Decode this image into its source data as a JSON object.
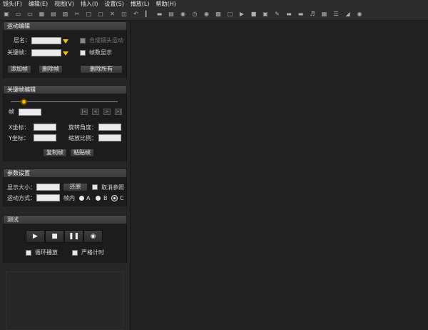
{
  "menubar": {
    "items": [
      {
        "label": "镜头(F)"
      },
      {
        "label": "编辑(E)"
      },
      {
        "label": "视图(V)"
      },
      {
        "label": "插入(I)"
      },
      {
        "label": "设置(S)"
      },
      {
        "label": "播放(L)"
      },
      {
        "label": "帮助(H)"
      }
    ]
  },
  "toolbar": {
    "icons": [
      "camera-icon",
      "open-folder-icon",
      "folder-icon",
      "save-icon",
      "save-as-icon",
      "film-icon",
      "cut-icon",
      "copy-icon",
      "paste-icon",
      "close-icon",
      "delete-icon",
      "undo-icon",
      "align-left-icon",
      "align-center-icon",
      "layer-icon",
      "web-icon",
      "timer-icon",
      "eye-icon",
      "layers-icon",
      "crop-icon",
      "play-icon",
      "stop-icon",
      "frame-icon",
      "pen-icon",
      "move-up-icon",
      "move-down-icon",
      "sound-icon",
      "grid-icon",
      "bars-icon",
      "chart-icon",
      "settings-icon"
    ]
  },
  "motion_edit": {
    "title": "运动编辑",
    "layer_name_label": "层名：",
    "layer_name_value": "",
    "composite_label": "合成镜头运动",
    "keyframe_label": "关键帧：",
    "keyframe_value": "",
    "frame_count_label": "帧数显示",
    "add_frame": "添加帧",
    "delete_frame": "删除帧",
    "delete_all": "删除所有"
  },
  "keyframe_edit": {
    "title": "关键帧编辑",
    "slider_fraction": 0.12,
    "frame_label": "帧",
    "frame_value": "",
    "nav_first": "|<",
    "nav_prev": "<",
    "nav_next": ">",
    "nav_last": ">|",
    "x_label": "X坐标：",
    "x_value": "",
    "rotation_label": "旋转角度：",
    "rotation_value": "",
    "y_label": "Y坐标：",
    "y_value": "",
    "scale_label": "缩放比例：",
    "scale_value": "",
    "copy_frame": "复制帧",
    "paste_frame": "粘贴帧"
  },
  "params": {
    "title": "参数设置",
    "display_size_label": "显示大小：",
    "display_size_value": "",
    "restore_button": "还原",
    "cancel_ref_label": "取消参照",
    "motion_mode_label": "运动方式：",
    "motion_mode_value": "",
    "inter_frame_label": "帧内",
    "option_a": "A",
    "option_b": "B",
    "option_c": "C"
  },
  "test": {
    "title": "测试",
    "loop_label": "循环播放",
    "strict_timing_label": "严格计时"
  }
}
